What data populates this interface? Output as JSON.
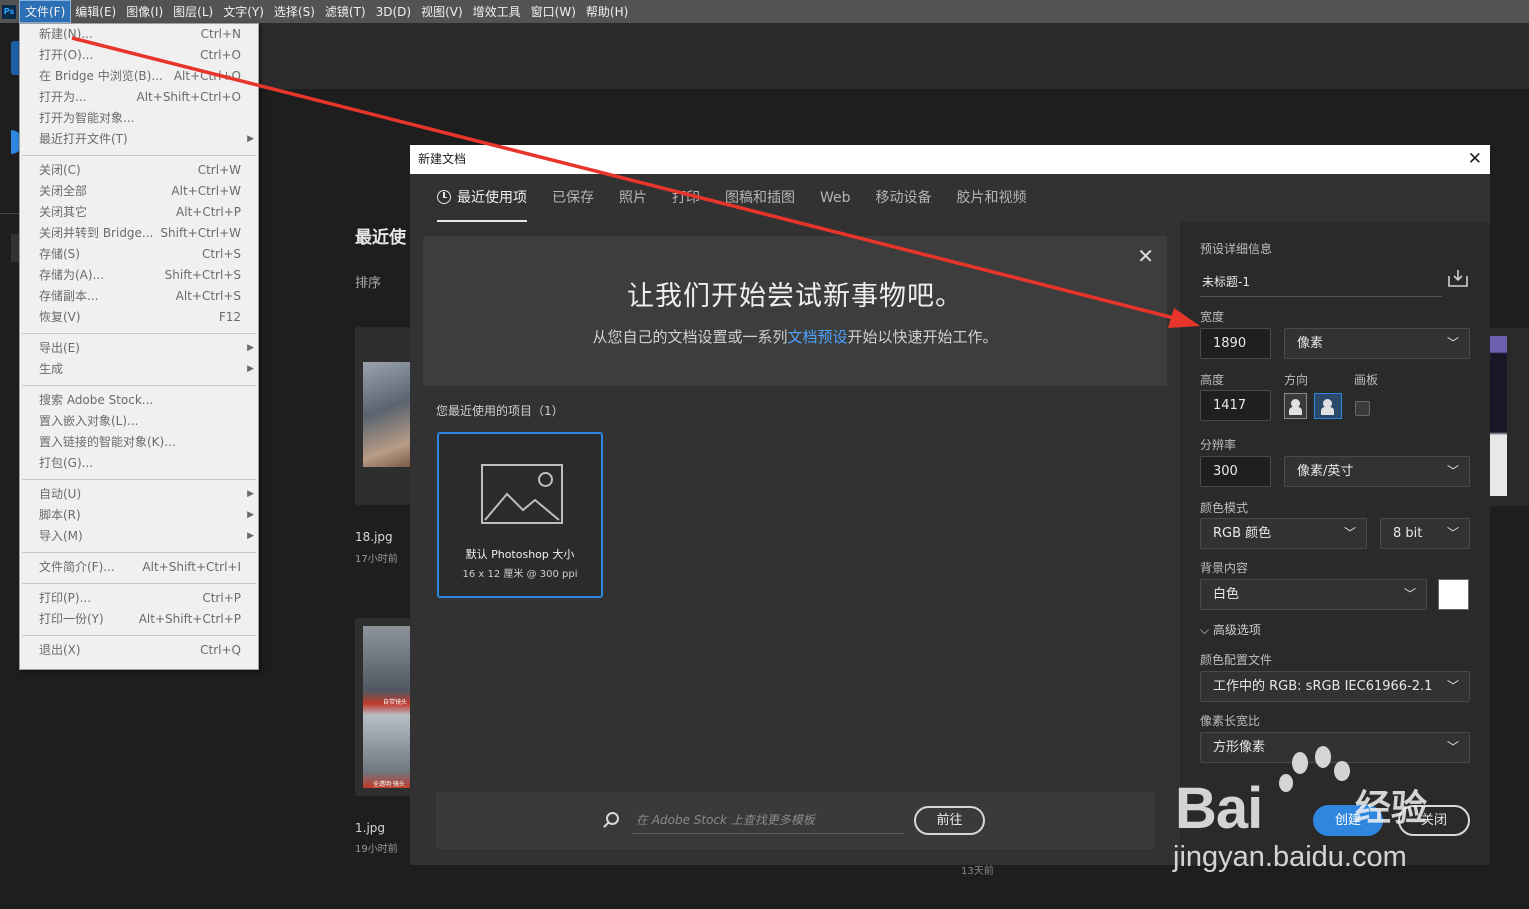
{
  "menubar": {
    "logo": "Ps",
    "items": [
      "文件(F)",
      "编辑(E)",
      "图像(I)",
      "图层(L)",
      "文字(Y)",
      "选择(S)",
      "滤镜(T)",
      "3D(D)",
      "视图(V)",
      "增效工具",
      "窗口(W)",
      "帮助(H)"
    ]
  },
  "file_menu": {
    "groups": [
      [
        {
          "label": "新建(N)...",
          "shortcut": "Ctrl+N"
        },
        {
          "label": "打开(O)...",
          "shortcut": "Ctrl+O"
        },
        {
          "label": "在 Bridge 中浏览(B)...",
          "shortcut": "Alt+Ctrl+O"
        },
        {
          "label": "打开为...",
          "shortcut": "Alt+Shift+Ctrl+O"
        },
        {
          "label": "打开为智能对象...",
          "shortcut": ""
        },
        {
          "label": "最近打开文件(T)",
          "shortcut": "",
          "submenu": true
        }
      ],
      [
        {
          "label": "关闭(C)",
          "shortcut": "Ctrl+W"
        },
        {
          "label": "关闭全部",
          "shortcut": "Alt+Ctrl+W"
        },
        {
          "label": "关闭其它",
          "shortcut": "Alt+Ctrl+P"
        },
        {
          "label": "关闭并转到 Bridge...",
          "shortcut": "Shift+Ctrl+W"
        },
        {
          "label": "存储(S)",
          "shortcut": "Ctrl+S"
        },
        {
          "label": "存储为(A)...",
          "shortcut": "Shift+Ctrl+S"
        },
        {
          "label": "存储副本...",
          "shortcut": "Alt+Ctrl+S"
        },
        {
          "label": "恢复(V)",
          "shortcut": "F12"
        }
      ],
      [
        {
          "label": "导出(E)",
          "shortcut": "",
          "submenu": true
        },
        {
          "label": "生成",
          "shortcut": "",
          "submenu": true
        }
      ],
      [
        {
          "label": "搜索 Adobe Stock...",
          "shortcut": ""
        },
        {
          "label": "置入嵌入对象(L)...",
          "shortcut": ""
        },
        {
          "label": "置入链接的智能对象(K)...",
          "shortcut": ""
        },
        {
          "label": "打包(G)...",
          "shortcut": ""
        }
      ],
      [
        {
          "label": "自动(U)",
          "shortcut": "",
          "submenu": true
        },
        {
          "label": "脚本(R)",
          "shortcut": "",
          "submenu": true
        },
        {
          "label": "导入(M)",
          "shortcut": "",
          "submenu": true
        }
      ],
      [
        {
          "label": "文件简介(F)...",
          "shortcut": "Alt+Shift+Ctrl+I"
        }
      ],
      [
        {
          "label": "打印(P)...",
          "shortcut": "Ctrl+P"
        },
        {
          "label": "打印一份(Y)",
          "shortcut": "Alt+Shift+Ctrl+P"
        }
      ],
      [
        {
          "label": "退出(X)",
          "shortcut": "Ctrl+Q"
        }
      ]
    ]
  },
  "home": {
    "title": "最近使",
    "sort_label": "排序",
    "files": [
      {
        "name": "18.jpg",
        "time": "17小时前"
      },
      {
        "name": "1.jpg",
        "time": "19小时前"
      }
    ],
    "thumb_labels": [
      "自带镜头",
      "全透明·镜头"
    ],
    "bottom_time": "13天前"
  },
  "dialog": {
    "title": "新建文档",
    "close": "✕",
    "tabs": [
      "最近使用项",
      "已保存",
      "照片",
      "打印",
      "图稿和插图",
      "Web",
      "移动设备",
      "胶片和视频"
    ],
    "banner": {
      "title": "让我们开始尝试新事物吧。",
      "sub_before": "从您自己的文档设置或一系列",
      "sub_link": "文档预设",
      "sub_after": "开始以快速开始工作。",
      "close": "✕"
    },
    "recent_label": "您最近使用的项目（1）",
    "preset": {
      "name": "默认 Photoshop 大小",
      "size": "16 x 12 厘米 @ 300 ppi"
    },
    "stock": {
      "placeholder": "在 Adobe Stock 上查找更多模板",
      "go": "前往"
    },
    "panel": {
      "heading": "预设详细信息",
      "doc_name": "未标题-1",
      "width_label": "宽度",
      "width": "1890",
      "width_unit": "像素",
      "height_label": "高度",
      "height": "1417",
      "orientation_label": "方向",
      "artboard_label": "画板",
      "resolution_label": "分辨率",
      "resolution": "300",
      "resolution_unit": "像素/英寸",
      "color_mode_label": "颜色模式",
      "color_mode": "RGB 颜色",
      "bit_depth": "8 bit",
      "background_label": "背景内容",
      "background": "白色",
      "advanced": "高级选项",
      "profile_label": "颜色配置文件",
      "profile": "工作中的 RGB: sRGB IEC61966-2.1",
      "aspect_label": "像素长宽比",
      "aspect": "方形像素",
      "create": "创建",
      "close": "关闭"
    }
  },
  "colors": {
    "accent": "#2e86de",
    "annotation_arrow": "#e8352b"
  },
  "watermark": {
    "brand": "Bai",
    "brand2": "经验",
    "url": "jingyan.baidu.com"
  }
}
